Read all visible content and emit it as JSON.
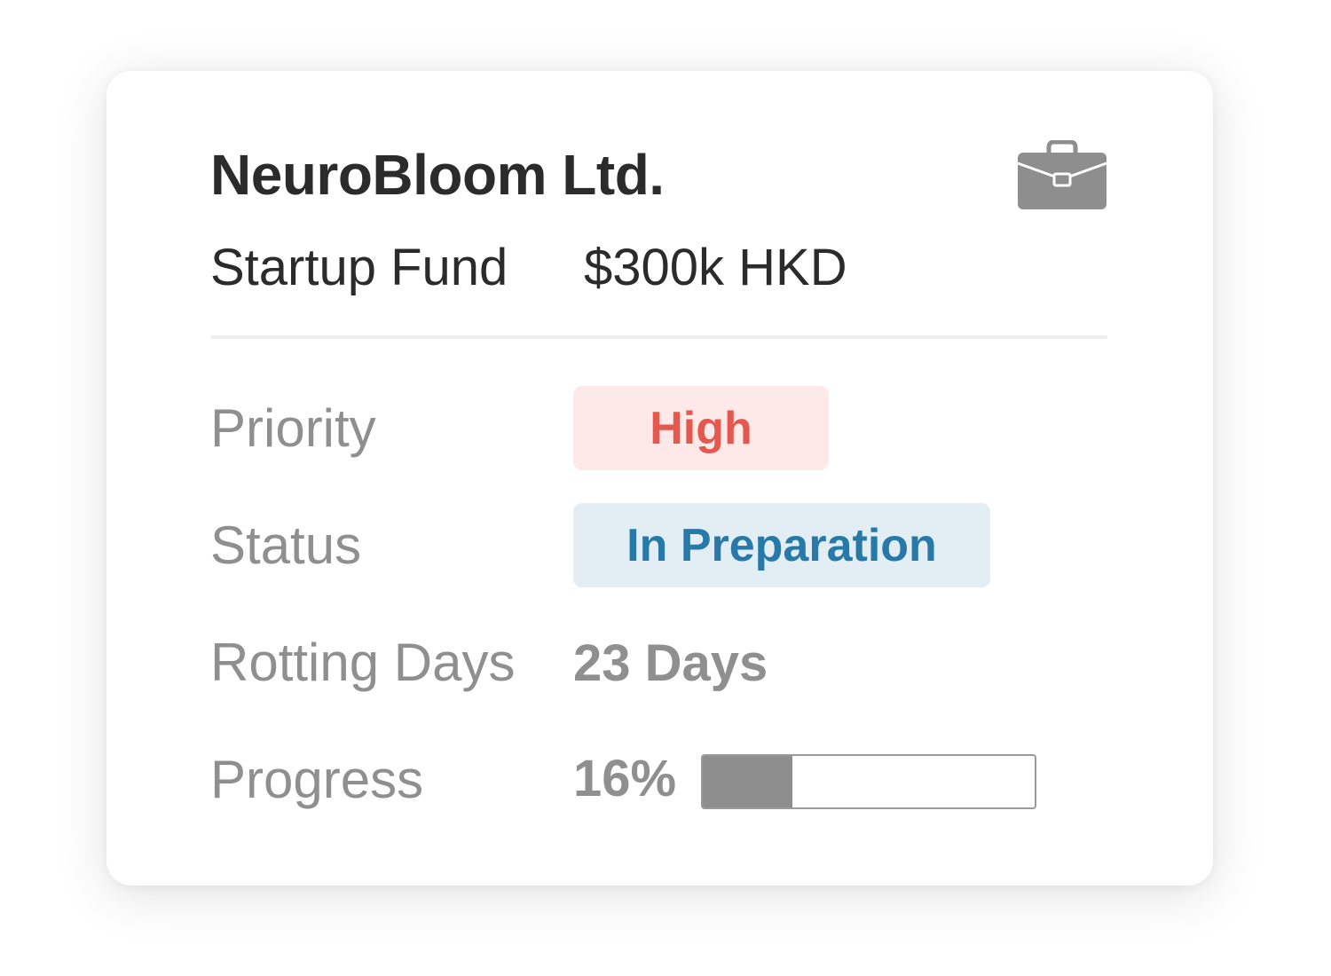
{
  "card": {
    "company_name": "NeuroBloom Ltd.",
    "icon": "briefcase-icon",
    "fund_label": "Startup Fund",
    "fund_amount": "$300k HKD"
  },
  "details": {
    "priority_label": "Priority",
    "priority_value": "High",
    "status_label": "Status",
    "status_value": "In Preparation",
    "rotting_label": "Rotting Days",
    "rotting_value": "23 Days",
    "progress_label": "Progress",
    "progress_text": "16%",
    "progress_fraction": 0.27
  },
  "colors": {
    "priority_text": "#e5584f",
    "priority_bg": "#fde9e8",
    "status_text": "#2779a7",
    "status_bg": "#e3edf4",
    "icon": "#8e8e8e",
    "progress_fill": "#8e8e8e"
  }
}
